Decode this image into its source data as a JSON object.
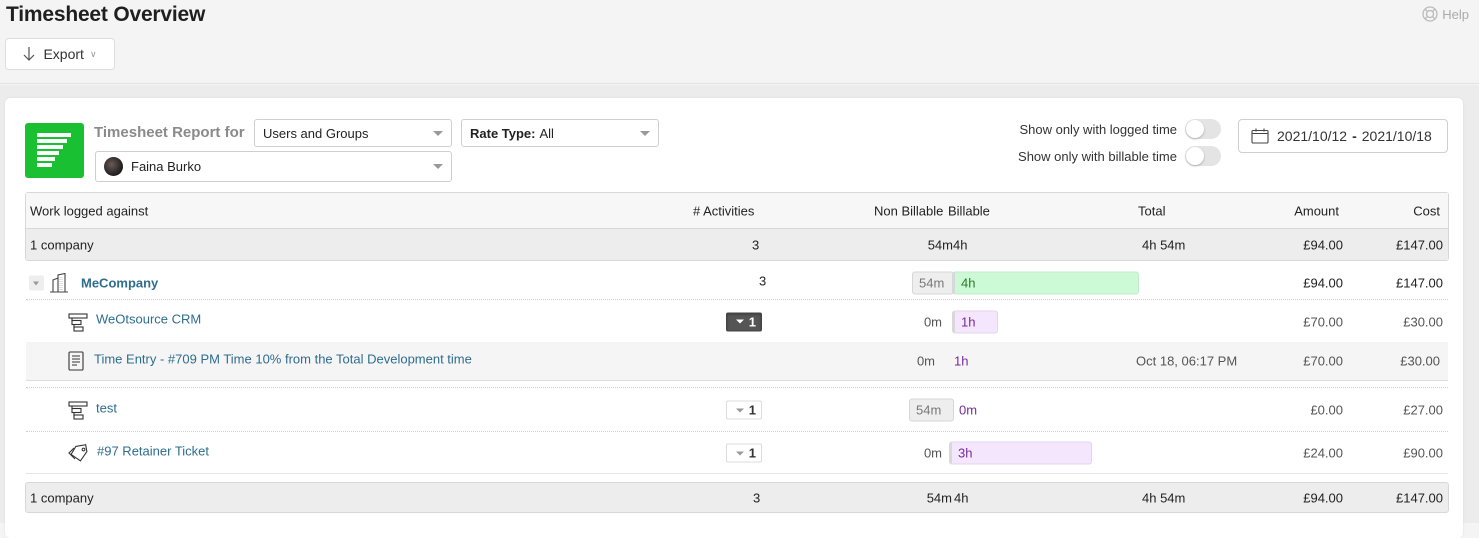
{
  "header": {
    "title": "Timesheet Overview",
    "help_label": "Help",
    "export_label": "Export"
  },
  "filters": {
    "report_label": "Timesheet Report for",
    "scope_select": "Users and Groups",
    "rate_type_label": "Rate Type:",
    "rate_type_value": "All",
    "user_select": "Faina Burko",
    "toggle_logged_label": "Show only with logged time",
    "toggle_logged_on": false,
    "toggle_billable_label": "Show only with billable time",
    "toggle_billable_on": false,
    "date_from": "2021/10/12",
    "date_sep": "-",
    "date_to": "2021/10/18"
  },
  "table": {
    "columns": {
      "work": "Work logged against",
      "activities": "# Activities",
      "non_billable": "Non Billable",
      "billable": "Billable",
      "total": "Total",
      "amount": "Amount",
      "cost": "Cost"
    },
    "summary_top": {
      "label": "1 company",
      "activities": "3",
      "non_billable": "54m",
      "billable": "4h",
      "total": "4h 54m",
      "amount": "£94.00",
      "cost": "£147.00"
    },
    "rows": [
      {
        "type": "company",
        "icon": "building-icon",
        "name": "MeCompany",
        "activities": "3",
        "non_billable": "54m",
        "billable": "4h",
        "amount": "£94.00",
        "cost": "£147.00"
      },
      {
        "type": "project",
        "icon": "project-icon",
        "name": "WeOtsource CRM",
        "activities": "1",
        "activities_expanded": true,
        "non_billable": "0m",
        "billable": "1h",
        "amount": "£70.00",
        "cost": "£30.00"
      },
      {
        "type": "entry",
        "icon": "document-icon",
        "name": "Time Entry - #709 PM Time 10% from the Total Development time",
        "non_billable": "0m",
        "billable": "1h",
        "total": "Oct 18, 06:17 PM",
        "amount": "£70.00",
        "cost": "£30.00"
      },
      {
        "type": "project",
        "icon": "project-icon",
        "name": "test",
        "activities": "1",
        "activities_expanded": false,
        "non_billable": "54m",
        "billable": "0m",
        "amount": "£0.00",
        "cost": "£27.00"
      },
      {
        "type": "ticket",
        "icon": "tag-icon",
        "name": "#97 Retainer Ticket",
        "activities": "1",
        "activities_expanded": false,
        "non_billable": "0m",
        "billable": "3h",
        "amount": "£24.00",
        "cost": "£90.00"
      }
    ],
    "summary_bottom": {
      "label": "1 company",
      "activities": "3",
      "non_billable": "54m",
      "billable": "4h",
      "total": "4h 54m",
      "amount": "£94.00",
      "cost": "£147.00"
    }
  },
  "colors": {
    "brand_green": "#19c132",
    "link_blue": "#2e6d8e",
    "billable_green_bg": "#cdfad6",
    "billable_purple_bg": "#f4e6fd",
    "billable_purple_text": "#7a2a99"
  }
}
